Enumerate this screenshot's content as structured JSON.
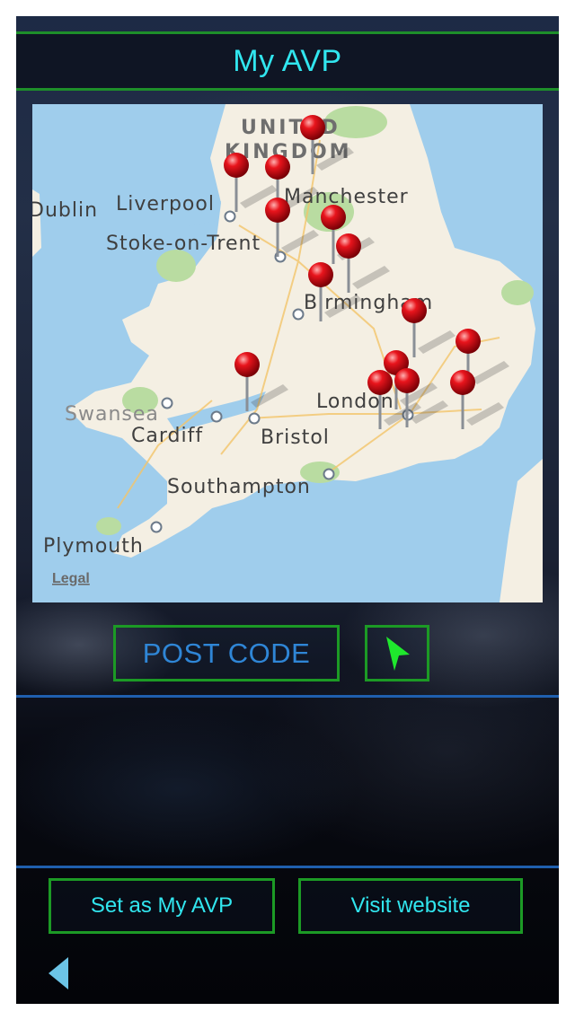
{
  "header": {
    "title": "My AVP"
  },
  "map": {
    "labels": {
      "united": "UNITED",
      "kingdom": "KINGDOM",
      "dublin": "Dublin",
      "liverpool": "Liverpool",
      "manchester": "Manchester",
      "stoke": "Stoke-on-Trent",
      "birmingham": "Birmingham",
      "london": "London",
      "swansea": "Swansea",
      "cardiff": "Cardiff",
      "bristol": "Bristol",
      "southampton": "Southampton",
      "plymouth": "Plymouth"
    },
    "legal_link": "Legal",
    "colors": {
      "sea": "#9fcdec",
      "land": "#f4efe3",
      "park": "#b9dca1",
      "pin": "#e0141c"
    }
  },
  "controls": {
    "postcode_label": "POST CODE",
    "locate_icon": "location-arrow-icon"
  },
  "actions": {
    "set_label": "Set as My AVP",
    "visit_label": "Visit website",
    "back_icon": "back-triangle-icon"
  }
}
